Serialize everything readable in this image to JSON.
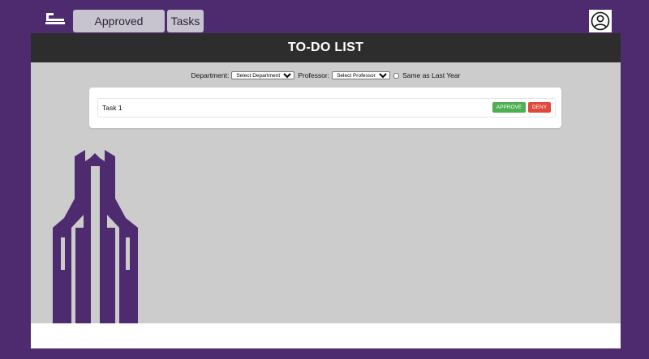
{
  "nav": {
    "items": [
      {
        "label": "Approved Sections"
      },
      {
        "label": "Tasks"
      }
    ],
    "logo_icon": "hammer-logo-icon",
    "avatar_icon": "user-circle-icon"
  },
  "header": {
    "title": "TO-DO LIST"
  },
  "filters": {
    "department_label": "Department:",
    "department_selected": "Select Department",
    "professor_label": "Professor:",
    "professor_selected": "Select Professor",
    "same_as_last_year_label": "Same as Last Year",
    "same_as_last_year_checked": false
  },
  "tasks": [
    {
      "name": "Task 1",
      "approve_label": "APPROVE",
      "deny_label": "DENY"
    }
  ],
  "colors": {
    "brand_purple": "#4e2a6e",
    "header_dark": "#2d2d2d",
    "panel_gray": "#cccccc",
    "approve_green": "#4caf50",
    "deny_red": "#e0483b"
  }
}
